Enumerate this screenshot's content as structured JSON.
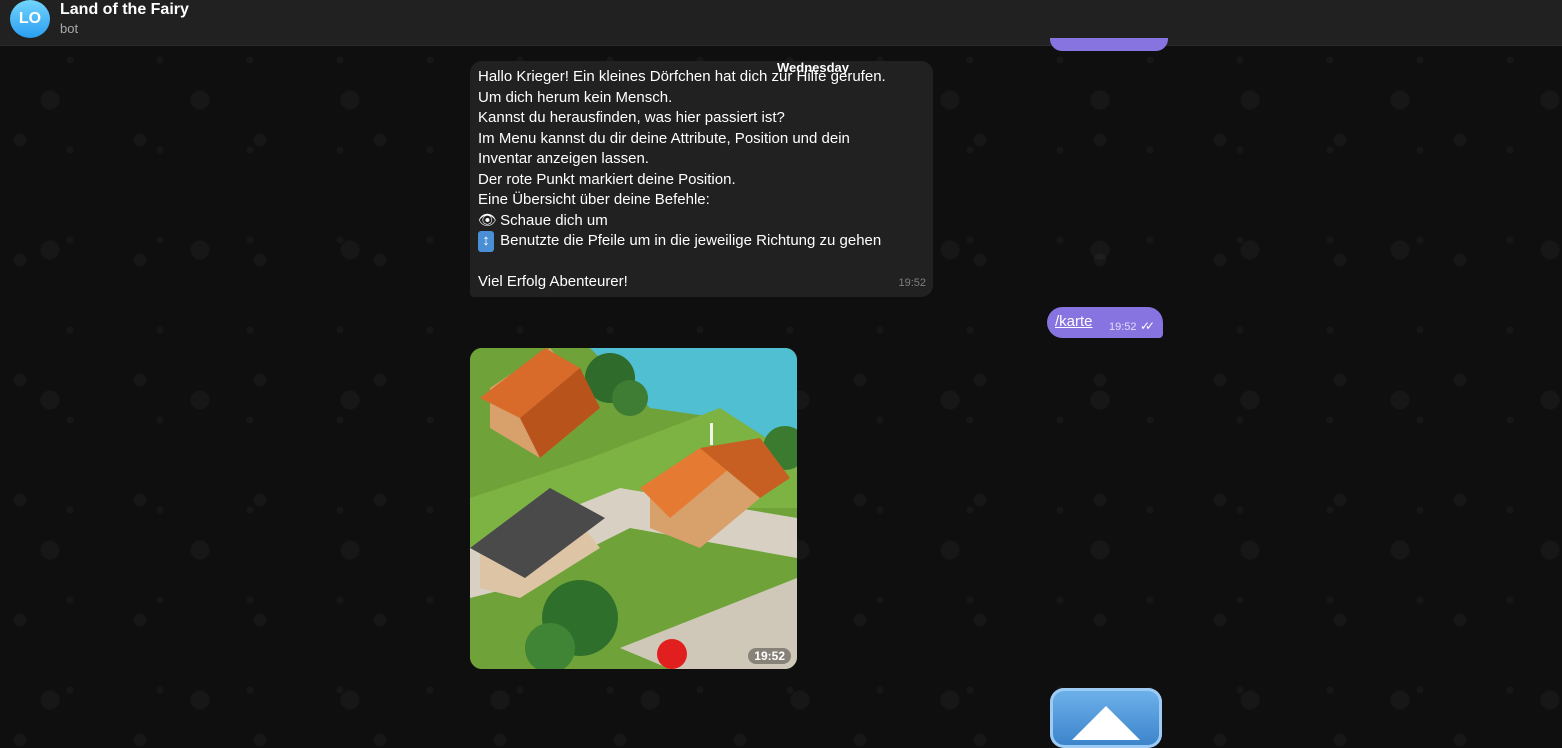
{
  "header": {
    "avatar_initials": "LO",
    "title": "Land of the Fairy",
    "subtitle": "bot"
  },
  "date_separator": "Wednesday",
  "incoming_message": {
    "lines": [
      "Hallo Krieger! Ein kleines Dörfchen hat dich zur Hilfe gerufen.",
      "Um dich herum kein Mensch.",
      "Kannst du herausfinden, was hier passiert ist?",
      "Im Menu kannst du dir deine Attribute, Position und dein",
      "Inventar anzeigen lassen.",
      "Der rote Punkt markiert deine Position.",
      "Eine Übersicht über deine Befehle:"
    ],
    "commands": [
      {
        "icon": "👁",
        "icon_name": "eye-icon",
        "text": "Schaue dich um"
      },
      {
        "icon": "↕",
        "icon_name": "up-down-arrow-icon",
        "text": "Benutzte die Pfeile um in die jeweilige Richtung zu gehen"
      }
    ],
    "closing": "Viel Erfolg Abenteurer!",
    "time": "19:52"
  },
  "outgoing_message": {
    "command": "/karte",
    "time": "19:52",
    "status_icon": "double-check-icon"
  },
  "photo_message": {
    "time": "19:52",
    "description_icon": "map-image"
  },
  "scroll_button": {
    "icon": "up-arrow-icon"
  },
  "colors": {
    "outgoing_bubble": "#8774e1",
    "incoming_bubble": "#212121",
    "header_bg": "#212121",
    "position_marker": "#e21f1f"
  }
}
